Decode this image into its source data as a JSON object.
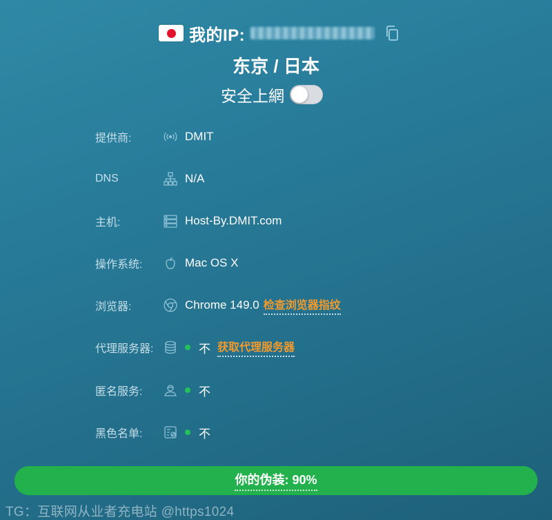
{
  "header": {
    "ip_label": "我的IP:",
    "location": "东京 / 日本",
    "safe_label": "安全上網",
    "safe_toggle_on": false,
    "flag": "japan-flag-icon",
    "copy_icon": "copy-icon"
  },
  "rows": [
    {
      "label": "提供商:",
      "icon": "signal-icon",
      "value": "DMIT"
    },
    {
      "label": "DNS",
      "icon": "network-tree-icon",
      "value": "N/A"
    },
    {
      "label": "主机:",
      "icon": "server-icon",
      "value": "Host-By.DMIT.com"
    },
    {
      "label": "操作系统:",
      "icon": "apple-icon",
      "value": "Mac OS X"
    },
    {
      "label": "浏览器:",
      "icon": "chrome-icon",
      "value": "Chrome 149.0",
      "link": "检查浏览器指纹"
    },
    {
      "label": "代理服务器:",
      "icon": "database-icon",
      "value": "不",
      "link": "获取代理服务器"
    },
    {
      "label": "匿名服务:",
      "icon": "user-icon",
      "value": "不"
    },
    {
      "label": "黑色名单:",
      "icon": "blacklist-icon",
      "value": "不"
    }
  ],
  "progress": {
    "label": "你的伪装: 90%",
    "percent": 90
  },
  "watermark": "TG：互联网从业者充电站 @https1024",
  "colors": {
    "accent_orange": "#f39a2c",
    "progress_green": "#22b14c",
    "status_dot_green": "#25c25a"
  }
}
